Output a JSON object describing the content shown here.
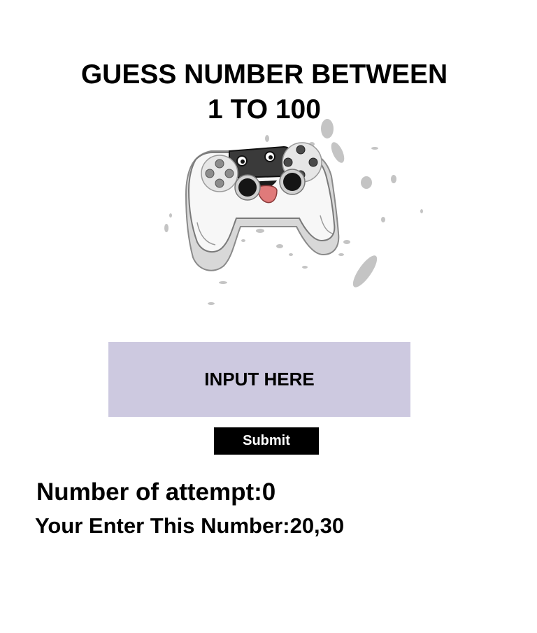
{
  "header": {
    "title_line1": "GUESS NUMBER BETWEEN",
    "title_line2": "1 TO 100"
  },
  "illustration": {
    "icon": "game-controller-icon"
  },
  "form": {
    "input_placeholder": "INPUT HERE",
    "submit_label": "Submit"
  },
  "status": {
    "attempts_label": "Number of attempt:",
    "attempts_value": "0",
    "entered_label": "Your Enter This Number:",
    "entered_value": "20,30"
  },
  "colors": {
    "input_background": "#cdc9e0",
    "button_background": "#000000",
    "button_text": "#ffffff"
  }
}
